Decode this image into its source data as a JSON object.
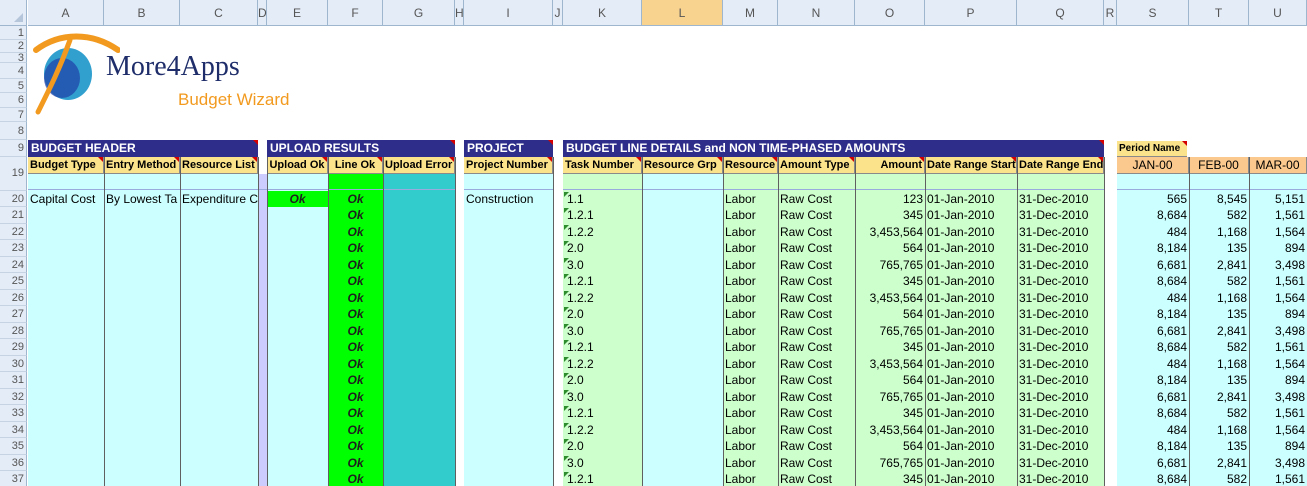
{
  "sheet": {
    "columns": [
      "A",
      "B",
      "C",
      "D",
      "E",
      "F",
      "G",
      "H",
      "I",
      "J",
      "K",
      "L",
      "M",
      "N",
      "O",
      "P",
      "Q",
      "R",
      "S",
      "T",
      "U"
    ],
    "selected_column": "L",
    "top_rows": [
      "1",
      "2",
      "3",
      "4",
      "5",
      "6",
      "7",
      "8",
      "9"
    ],
    "data_rows": [
      "19",
      "20",
      "21",
      "22",
      "23",
      "24",
      "25",
      "26",
      "27",
      "28",
      "29",
      "30",
      "31",
      "32",
      "33",
      "34",
      "35",
      "36",
      "37"
    ]
  },
  "logo": {
    "title": "More4Apps",
    "subtitle": "Budget Wizard",
    "colors": {
      "orange": "#f29a1f",
      "blue": "#1f3fa6",
      "teal": "#0e8fc7",
      "title": "#1f2e6a"
    }
  },
  "sections": {
    "budget_header": "BUDGET HEADER",
    "upload_results": "UPLOAD RESULTS",
    "project": "PROJECT",
    "budget_lines": "BUDGET LINE DETAILS and NON TIME-PHASED AMOUNTS",
    "period_name": "Period Name"
  },
  "headers": {
    "budget_type": "Budget Type",
    "entry_method": "Entry Method",
    "resource_list": "Resource List",
    "upload_ok": "Upload Ok",
    "line_ok": "Line Ok",
    "upload_error": "Upload Error",
    "project_number": "Project Number",
    "task_number": "Task Number",
    "resource_grp": "Resource Grp",
    "resource": "Resource",
    "amount_type": "Amount Type",
    "amount": "Amount",
    "date_range_start": "Date Range Start",
    "date_range_end": "Date Range End",
    "periods": [
      "JAN-00",
      "FEB-00",
      "MAR-00"
    ]
  },
  "header_row": {
    "budget_type": "Capital Cost",
    "entry_method": "By Lowest Ta",
    "resource_list": "Expenditure Ca",
    "upload_ok": "Ok",
    "project_number": "Construction"
  },
  "lines": [
    {
      "row": "20",
      "line_ok": "Ok",
      "task": "1.1",
      "resource": "Labor",
      "amount_type": "Raw Cost",
      "amount": "123",
      "start": "01-Jan-2010",
      "end": "31-Dec-2010",
      "p1": "565",
      "p2": "8,545",
      "p3": "5,151"
    },
    {
      "row": "21",
      "line_ok": "Ok",
      "task": "1.2.1",
      "resource": "Labor",
      "amount_type": "Raw Cost",
      "amount": "345",
      "start": "01-Jan-2010",
      "end": "31-Dec-2010",
      "p1": "8,684",
      "p2": "582",
      "p3": "1,561"
    },
    {
      "row": "22",
      "line_ok": "Ok",
      "task": "1.2.2",
      "resource": "Labor",
      "amount_type": "Raw Cost",
      "amount": "3,453,564",
      "start": "01-Jan-2010",
      "end": "31-Dec-2010",
      "p1": "484",
      "p2": "1,168",
      "p3": "1,564"
    },
    {
      "row": "23",
      "line_ok": "Ok",
      "task": "2.0",
      "resource": "Labor",
      "amount_type": "Raw Cost",
      "amount": "564",
      "start": "01-Jan-2010",
      "end": "31-Dec-2010",
      "p1": "8,184",
      "p2": "135",
      "p3": "894"
    },
    {
      "row": "24",
      "line_ok": "Ok",
      "task": "3.0",
      "resource": "Labor",
      "amount_type": "Raw Cost",
      "amount": "765,765",
      "start": "01-Jan-2010",
      "end": "31-Dec-2010",
      "p1": "6,681",
      "p2": "2,841",
      "p3": "3,498"
    },
    {
      "row": "25",
      "line_ok": "Ok",
      "task": "1.2.1",
      "resource": "Labor",
      "amount_type": "Raw Cost",
      "amount": "345",
      "start": "01-Jan-2010",
      "end": "31-Dec-2010",
      "p1": "8,684",
      "p2": "582",
      "p3": "1,561"
    },
    {
      "row": "26",
      "line_ok": "Ok",
      "task": "1.2.2",
      "resource": "Labor",
      "amount_type": "Raw Cost",
      "amount": "3,453,564",
      "start": "01-Jan-2010",
      "end": "31-Dec-2010",
      "p1": "484",
      "p2": "1,168",
      "p3": "1,564"
    },
    {
      "row": "27",
      "line_ok": "Ok",
      "task": "2.0",
      "resource": "Labor",
      "amount_type": "Raw Cost",
      "amount": "564",
      "start": "01-Jan-2010",
      "end": "31-Dec-2010",
      "p1": "8,184",
      "p2": "135",
      "p3": "894"
    },
    {
      "row": "28",
      "line_ok": "Ok",
      "task": "3.0",
      "resource": "Labor",
      "amount_type": "Raw Cost",
      "amount": "765,765",
      "start": "01-Jan-2010",
      "end": "31-Dec-2010",
      "p1": "6,681",
      "p2": "2,841",
      "p3": "3,498"
    },
    {
      "row": "29",
      "line_ok": "Ok",
      "task": "1.2.1",
      "resource": "Labor",
      "amount_type": "Raw Cost",
      "amount": "345",
      "start": "01-Jan-2010",
      "end": "31-Dec-2010",
      "p1": "8,684",
      "p2": "582",
      "p3": "1,561"
    },
    {
      "row": "30",
      "line_ok": "Ok",
      "task": "1.2.2",
      "resource": "Labor",
      "amount_type": "Raw Cost",
      "amount": "3,453,564",
      "start": "01-Jan-2010",
      "end": "31-Dec-2010",
      "p1": "484",
      "p2": "1,168",
      "p3": "1,564"
    },
    {
      "row": "31",
      "line_ok": "Ok",
      "task": "2.0",
      "resource": "Labor",
      "amount_type": "Raw Cost",
      "amount": "564",
      "start": "01-Jan-2010",
      "end": "31-Dec-2010",
      "p1": "8,184",
      "p2": "135",
      "p3": "894"
    },
    {
      "row": "32",
      "line_ok": "Ok",
      "task": "3.0",
      "resource": "Labor",
      "amount_type": "Raw Cost",
      "amount": "765,765",
      "start": "01-Jan-2010",
      "end": "31-Dec-2010",
      "p1": "6,681",
      "p2": "2,841",
      "p3": "3,498"
    },
    {
      "row": "33",
      "line_ok": "Ok",
      "task": "1.2.1",
      "resource": "Labor",
      "amount_type": "Raw Cost",
      "amount": "345",
      "start": "01-Jan-2010",
      "end": "31-Dec-2010",
      "p1": "8,684",
      "p2": "582",
      "p3": "1,561"
    },
    {
      "row": "34",
      "line_ok": "Ok",
      "task": "1.2.2",
      "resource": "Labor",
      "amount_type": "Raw Cost",
      "amount": "3,453,564",
      "start": "01-Jan-2010",
      "end": "31-Dec-2010",
      "p1": "484",
      "p2": "1,168",
      "p3": "1,564"
    },
    {
      "row": "35",
      "line_ok": "Ok",
      "task": "2.0",
      "resource": "Labor",
      "amount_type": "Raw Cost",
      "amount": "564",
      "start": "01-Jan-2010",
      "end": "31-Dec-2010",
      "p1": "8,184",
      "p2": "135",
      "p3": "894"
    },
    {
      "row": "36",
      "line_ok": "Ok",
      "task": "3.0",
      "resource": "Labor",
      "amount_type": "Raw Cost",
      "amount": "765,765",
      "start": "01-Jan-2010",
      "end": "31-Dec-2010",
      "p1": "6,681",
      "p2": "2,841",
      "p3": "3,498"
    },
    {
      "row": "37",
      "line_ok": "Ok",
      "task": "1.2.1",
      "resource": "Labor",
      "amount_type": "Raw Cost",
      "amount": "345",
      "start": "01-Jan-2010",
      "end": "31-Dec-2010",
      "p1": "8,684",
      "p2": "582",
      "p3": "1,561"
    }
  ],
  "colors": {
    "band": "#2e2e8a",
    "subheader": "#fbe38c",
    "period_header": "#fbc98e",
    "cyan": "#ccffff",
    "light_green": "#ccffcc",
    "green": "#00ff00",
    "teal": "#33cccc",
    "lavender": "#ccccff",
    "grid_header": "#e4ecf7",
    "selected_header": "#f8d38f"
  }
}
